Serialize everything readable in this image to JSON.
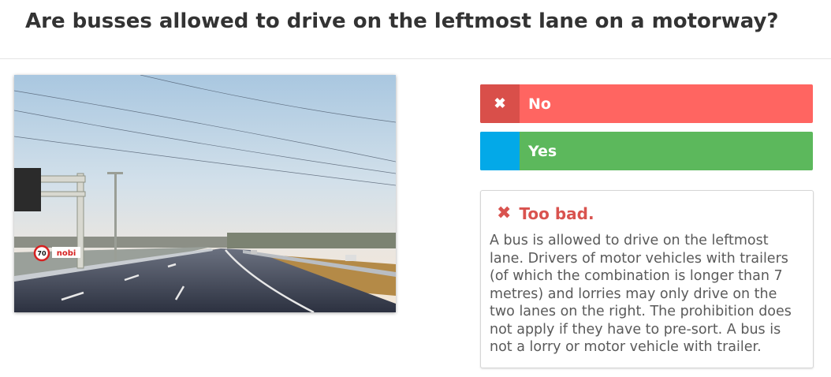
{
  "question": "Are busses allowed to drive on the leftmost lane on a motorway?",
  "image": {
    "description_icon": "motorway-photo",
    "speed_sign": "70",
    "sign_text": "nobi"
  },
  "answers": [
    {
      "label": "No",
      "icon": "close-icon",
      "state": "selected-wrong"
    },
    {
      "label": "Yes",
      "icon": "",
      "state": "correct"
    }
  ],
  "feedback": {
    "icon": "close-icon",
    "title": "Too bad.",
    "text": "A bus is allowed to drive on the leftmost lane. Drivers of motor vehicles with trailers (of which the combination is longer than 7 metres) and lorries may only drive on the two lanes on the right. The prohibition does not apply if they have to pre-sort. A bus is not a lorry or motor vehicle with trailer."
  },
  "colors": {
    "wrong": "#ff6561",
    "wrong_icon_bg": "#d94f4a",
    "correct": "#5cb85c",
    "correct_icon_bg": "#03a9e8",
    "feedback_title": "#d9534f"
  }
}
